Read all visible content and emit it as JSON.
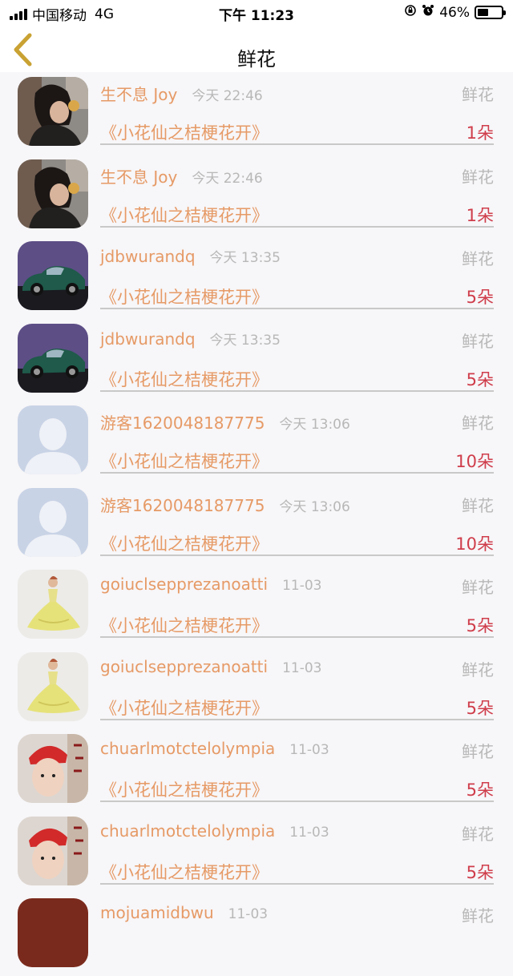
{
  "status": {
    "carrier": "中国移动",
    "network": "4G",
    "time": "下午 11:23",
    "battery": "46%",
    "battery_level": 0.46
  },
  "nav": {
    "title": "鲜花",
    "back_icon": "chevron-left-icon",
    "back_color": "#c9a233"
  },
  "colors": {
    "name": "#e69a66",
    "count": "#cf3d4b",
    "muted": "#b8b8b8"
  },
  "items": [
    {
      "name": "生不息 Joy",
      "time": "今天 22:46",
      "type": "鲜花",
      "book": "《小花仙之桔梗花开》",
      "count": "1朵",
      "avatar": "girl-photo"
    },
    {
      "name": "生不息 Joy",
      "time": "今天 22:46",
      "type": "鲜花",
      "book": "《小花仙之桔梗花开》",
      "count": "1朵",
      "avatar": "girl-photo"
    },
    {
      "name": "jdbwurandq",
      "time": "今天 13:35",
      "type": "鲜花",
      "book": "《小花仙之桔梗花开》",
      "count": "5朵",
      "avatar": "green-car"
    },
    {
      "name": "jdbwurandq",
      "time": "今天 13:35",
      "type": "鲜花",
      "book": "《小花仙之桔梗花开》",
      "count": "5朵",
      "avatar": "green-car"
    },
    {
      "name": "游客1620048187775",
      "time": "今天 13:06",
      "type": "鲜花",
      "book": "《小花仙之桔梗花开》",
      "count": "10朵",
      "avatar": "default-user"
    },
    {
      "name": "游客1620048187775",
      "time": "今天 13:06",
      "type": "鲜花",
      "book": "《小花仙之桔梗花开》",
      "count": "10朵",
      "avatar": "default-user"
    },
    {
      "name": "goiuclsepprezanoatti",
      "time": "11-03",
      "type": "鲜花",
      "book": "《小花仙之桔梗花开》",
      "count": "5朵",
      "avatar": "yellow-dress"
    },
    {
      "name": "goiuclsepprezanoatti",
      "time": "11-03",
      "type": "鲜花",
      "book": "《小花仙之桔梗花开》",
      "count": "5朵",
      "avatar": "yellow-dress"
    },
    {
      "name": "chuarlmotctelolympia",
      "time": "11-03",
      "type": "鲜花",
      "book": "《小花仙之桔梗花开》",
      "count": "5朵",
      "avatar": "red-cap-boy"
    },
    {
      "name": "chuarlmotctelolympia",
      "time": "11-03",
      "type": "鲜花",
      "book": "《小花仙之桔梗花开》",
      "count": "5朵",
      "avatar": "red-cap-boy"
    },
    {
      "name": "mojuamidbwu",
      "time": "11-03",
      "type": "鲜花",
      "book": "",
      "count": "",
      "avatar": "dark-red"
    }
  ]
}
